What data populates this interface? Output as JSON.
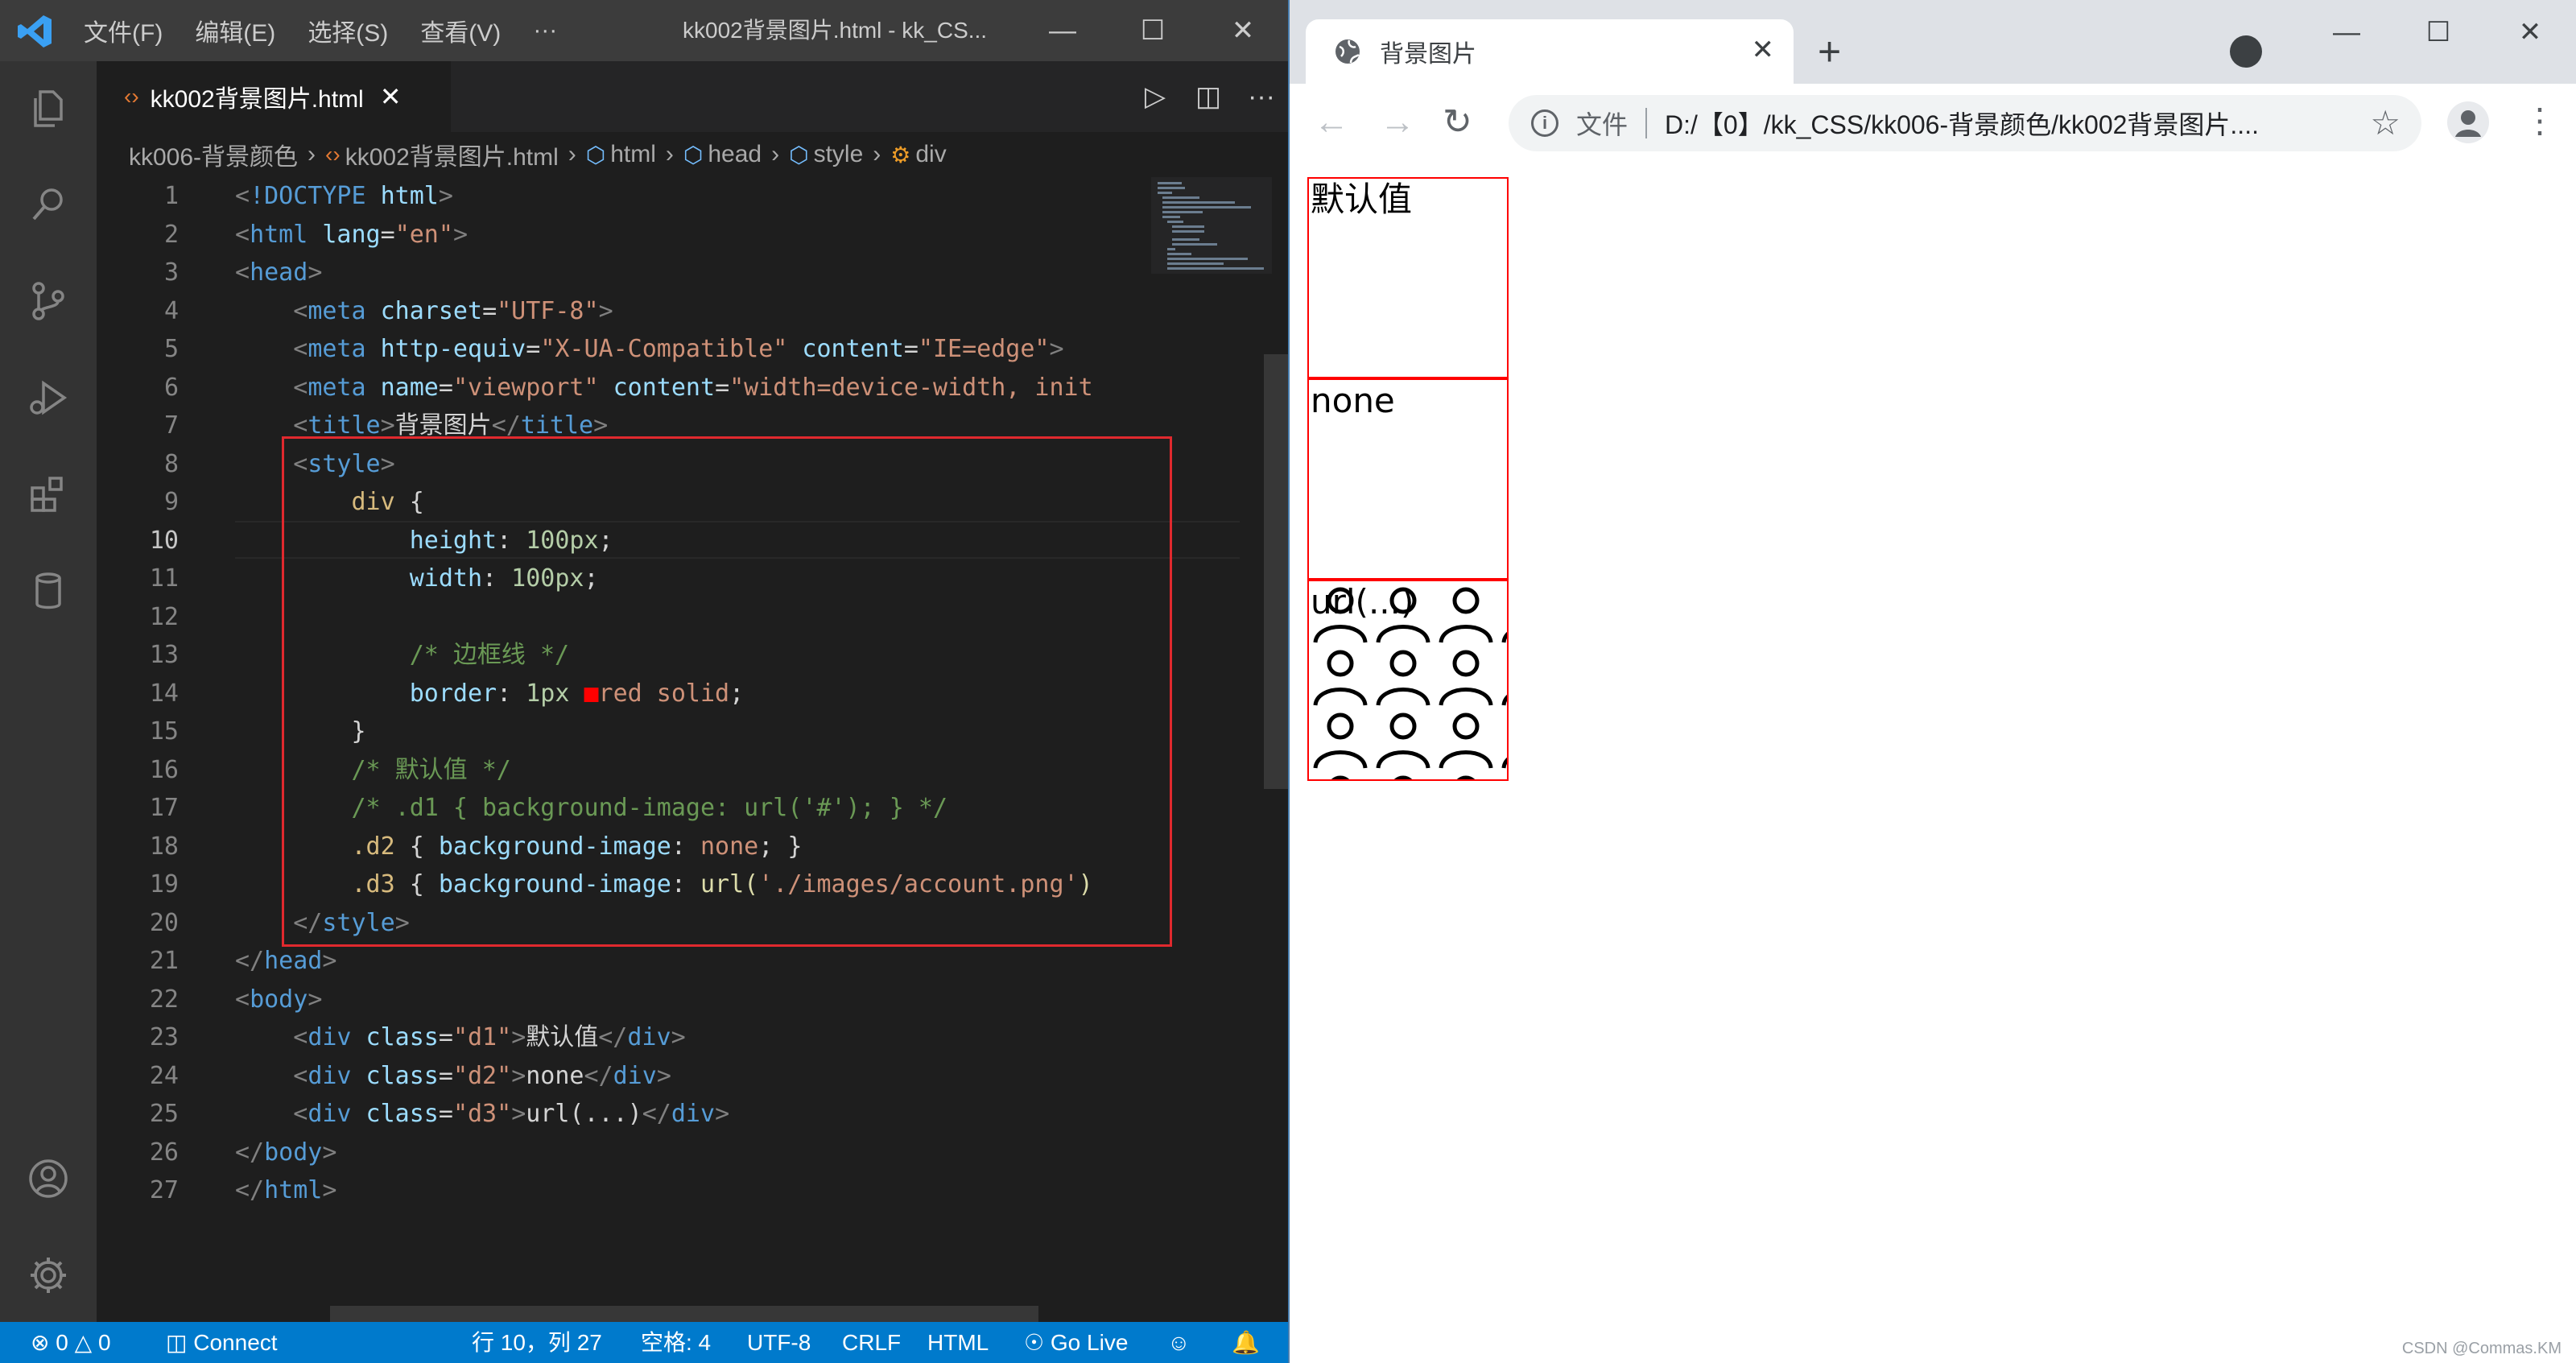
{
  "vscode": {
    "menu": [
      "文件(F)",
      "编辑(E)",
      "选择(S)",
      "查看(V)",
      "···"
    ],
    "window_title": "kk002背景图片.html - kk_CS...",
    "tab": {
      "label": "kk002背景图片.html",
      "icon": "‹›"
    },
    "breadcrumb": {
      "folder": "kk006-背景颜色",
      "file": "kk002背景图片.html",
      "html": "html",
      "head": "head",
      "style": "style",
      "div": "div"
    },
    "line_numbers": [
      "1",
      "2",
      "3",
      "4",
      "5",
      "6",
      "7",
      "8",
      "9",
      "10",
      "11",
      "12",
      "13",
      "14",
      "15",
      "16",
      "17",
      "18",
      "19",
      "20",
      "21",
      "22",
      "23",
      "24",
      "25",
      "26",
      "27"
    ],
    "current_line": "10",
    "status": {
      "errors": "0",
      "warnings": "0",
      "connect": "Connect",
      "position": "行 10，列 27",
      "spaces": "空格: 4",
      "encoding": "UTF-8",
      "eol": "CRLF",
      "language": "HTML",
      "golive": "Go Live"
    }
  },
  "code_lines": [
    [
      {
        "t": "<",
        "c": "#808080"
      },
      {
        "t": "!DOCTYPE",
        "c": "#569cd6"
      },
      {
        "t": " html",
        "c": "#9cdcfe"
      },
      {
        "t": ">",
        "c": "#808080"
      }
    ],
    [
      {
        "t": "<",
        "c": "#808080"
      },
      {
        "t": "html",
        "c": "#569cd6"
      },
      {
        "t": " lang",
        "c": "#9cdcfe"
      },
      {
        "t": "=",
        "c": "#d4d4d4"
      },
      {
        "t": "\"en\"",
        "c": "#ce9178"
      },
      {
        "t": ">",
        "c": "#808080"
      }
    ],
    [
      {
        "t": "<",
        "c": "#808080"
      },
      {
        "t": "head",
        "c": "#569cd6"
      },
      {
        "t": ">",
        "c": "#808080"
      }
    ],
    [
      {
        "t": "    <",
        "c": "#808080"
      },
      {
        "t": "meta",
        "c": "#569cd6"
      },
      {
        "t": " charset",
        "c": "#9cdcfe"
      },
      {
        "t": "=",
        "c": "#d4d4d4"
      },
      {
        "t": "\"UTF-8\"",
        "c": "#ce9178"
      },
      {
        "t": ">",
        "c": "#808080"
      }
    ],
    [
      {
        "t": "    <",
        "c": "#808080"
      },
      {
        "t": "meta",
        "c": "#569cd6"
      },
      {
        "t": " http-equiv",
        "c": "#9cdcfe"
      },
      {
        "t": "=",
        "c": "#d4d4d4"
      },
      {
        "t": "\"X-UA-Compatible\"",
        "c": "#ce9178"
      },
      {
        "t": " content",
        "c": "#9cdcfe"
      },
      {
        "t": "=",
        "c": "#d4d4d4"
      },
      {
        "t": "\"IE=edge\"",
        "c": "#ce9178"
      },
      {
        "t": ">",
        "c": "#808080"
      }
    ],
    [
      {
        "t": "    <",
        "c": "#808080"
      },
      {
        "t": "meta",
        "c": "#569cd6"
      },
      {
        "t": " name",
        "c": "#9cdcfe"
      },
      {
        "t": "=",
        "c": "#d4d4d4"
      },
      {
        "t": "\"viewport\"",
        "c": "#ce9178"
      },
      {
        "t": " content",
        "c": "#9cdcfe"
      },
      {
        "t": "=",
        "c": "#d4d4d4"
      },
      {
        "t": "\"width=device-width, init",
        "c": "#ce9178"
      }
    ],
    [
      {
        "t": "    <",
        "c": "#808080"
      },
      {
        "t": "title",
        "c": "#569cd6"
      },
      {
        "t": ">",
        "c": "#808080"
      },
      {
        "t": "背景图片",
        "c": "#d4d4d4"
      },
      {
        "t": "</",
        "c": "#808080"
      },
      {
        "t": "title",
        "c": "#569cd6"
      },
      {
        "t": ">",
        "c": "#808080"
      }
    ],
    [
      {
        "t": "    <",
        "c": "#808080"
      },
      {
        "t": "style",
        "c": "#569cd6"
      },
      {
        "t": ">",
        "c": "#808080"
      }
    ],
    [
      {
        "t": "        div",
        "c": "#d7ba7d"
      },
      {
        "t": " {",
        "c": "#d4d4d4"
      }
    ],
    [
      {
        "t": "            height",
        "c": "#9cdcfe"
      },
      {
        "t": ": ",
        "c": "#d4d4d4"
      },
      {
        "t": "100px",
        "c": "#b5cea8"
      },
      {
        "t": ";",
        "c": "#d4d4d4"
      }
    ],
    [
      {
        "t": "            width",
        "c": "#9cdcfe"
      },
      {
        "t": ": ",
        "c": "#d4d4d4"
      },
      {
        "t": "100px",
        "c": "#b5cea8"
      },
      {
        "t": ";",
        "c": "#d4d4d4"
      }
    ],
    [
      {
        "t": "",
        "c": "#d4d4d4"
      }
    ],
    [
      {
        "t": "            /* 边框线 */",
        "c": "#6a9955"
      }
    ],
    [
      {
        "t": "            border",
        "c": "#9cdcfe"
      },
      {
        "t": ": ",
        "c": "#d4d4d4"
      },
      {
        "t": "1px ",
        "c": "#b5cea8"
      },
      {
        "t": "■",
        "c": "#ff0000"
      },
      {
        "t": "red solid",
        "c": "#ce9178"
      },
      {
        "t": ";",
        "c": "#d4d4d4"
      }
    ],
    [
      {
        "t": "        }",
        "c": "#d4d4d4"
      }
    ],
    [
      {
        "t": "        /* 默认值 */",
        "c": "#6a9955"
      }
    ],
    [
      {
        "t": "        /* .d1 { background-image: url('#'); } */",
        "c": "#6a9955"
      }
    ],
    [
      {
        "t": "        .d2",
        "c": "#d7ba7d"
      },
      {
        "t": " { ",
        "c": "#d4d4d4"
      },
      {
        "t": "background-image",
        "c": "#9cdcfe"
      },
      {
        "t": ": ",
        "c": "#d4d4d4"
      },
      {
        "t": "none",
        "c": "#ce9178"
      },
      {
        "t": "; }",
        "c": "#d4d4d4"
      }
    ],
    [
      {
        "t": "        .d3",
        "c": "#d7ba7d"
      },
      {
        "t": " { ",
        "c": "#d4d4d4"
      },
      {
        "t": "background-image",
        "c": "#9cdcfe"
      },
      {
        "t": ": ",
        "c": "#d4d4d4"
      },
      {
        "t": "url(",
        "c": "#dcdcaa"
      },
      {
        "t": "'./images/account.png'",
        "c": "#ce9178"
      },
      {
        "t": ")",
        "c": "#dcdcaa"
      }
    ],
    [
      {
        "t": "    </",
        "c": "#808080"
      },
      {
        "t": "style",
        "c": "#569cd6"
      },
      {
        "t": ">",
        "c": "#808080"
      }
    ],
    [
      {
        "t": "</",
        "c": "#808080"
      },
      {
        "t": "head",
        "c": "#569cd6"
      },
      {
        "t": ">",
        "c": "#808080"
      }
    ],
    [
      {
        "t": "<",
        "c": "#808080"
      },
      {
        "t": "body",
        "c": "#569cd6"
      },
      {
        "t": ">",
        "c": "#808080"
      }
    ],
    [
      {
        "t": "    <",
        "c": "#808080"
      },
      {
        "t": "div",
        "c": "#569cd6"
      },
      {
        "t": " class",
        "c": "#9cdcfe"
      },
      {
        "t": "=",
        "c": "#d4d4d4"
      },
      {
        "t": "\"d1\"",
        "c": "#ce9178"
      },
      {
        "t": ">",
        "c": "#808080"
      },
      {
        "t": "默认值",
        "c": "#d4d4d4"
      },
      {
        "t": "</",
        "c": "#808080"
      },
      {
        "t": "div",
        "c": "#569cd6"
      },
      {
        "t": ">",
        "c": "#808080"
      }
    ],
    [
      {
        "t": "    <",
        "c": "#808080"
      },
      {
        "t": "div",
        "c": "#569cd6"
      },
      {
        "t": " class",
        "c": "#9cdcfe"
      },
      {
        "t": "=",
        "c": "#d4d4d4"
      },
      {
        "t": "\"d2\"",
        "c": "#ce9178"
      },
      {
        "t": ">",
        "c": "#808080"
      },
      {
        "t": "none",
        "c": "#d4d4d4"
      },
      {
        "t": "</",
        "c": "#808080"
      },
      {
        "t": "div",
        "c": "#569cd6"
      },
      {
        "t": ">",
        "c": "#808080"
      }
    ],
    [
      {
        "t": "    <",
        "c": "#808080"
      },
      {
        "t": "div",
        "c": "#569cd6"
      },
      {
        "t": " class",
        "c": "#9cdcfe"
      },
      {
        "t": "=",
        "c": "#d4d4d4"
      },
      {
        "t": "\"d3\"",
        "c": "#ce9178"
      },
      {
        "t": ">",
        "c": "#808080"
      },
      {
        "t": "url(...)",
        "c": "#d4d4d4"
      },
      {
        "t": "</",
        "c": "#808080"
      },
      {
        "t": "div",
        "c": "#569cd6"
      },
      {
        "t": ">",
        "c": "#808080"
      }
    ],
    [
      {
        "t": "</",
        "c": "#808080"
      },
      {
        "t": "body",
        "c": "#569cd6"
      },
      {
        "t": ">",
        "c": "#808080"
      }
    ],
    [
      {
        "t": "</",
        "c": "#808080"
      },
      {
        "t": "html",
        "c": "#569cd6"
      },
      {
        "t": ">",
        "c": "#808080"
      }
    ]
  ],
  "chrome": {
    "tab_title": "背景图片",
    "scheme_label": "文件",
    "url": "D:/【0】/kk_CSS/kk006-背景颜色/kk002背景图片....",
    "divs": [
      "默认值",
      "none",
      "url(...)"
    ],
    "border_color": "#ff0000"
  },
  "watermark": "CSDN @Commas.KM"
}
